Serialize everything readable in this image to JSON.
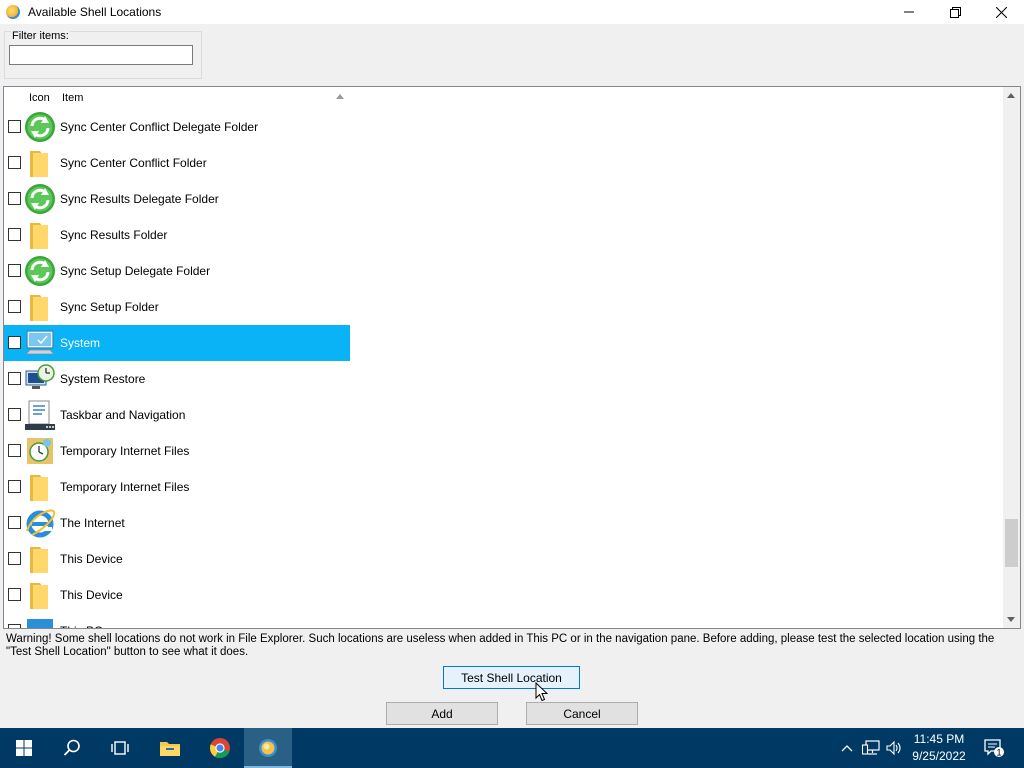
{
  "window": {
    "title": "Available Shell Locations"
  },
  "filter": {
    "label": "Filter items:",
    "value": "",
    "placeholder": ""
  },
  "list": {
    "columns": [
      "Icon",
      "Item"
    ],
    "items": [
      {
        "label": "Sync Center Conflict Delegate Folder",
        "icon": "sync-icon",
        "checked": false,
        "selected": false
      },
      {
        "label": "Sync Center Conflict Folder",
        "icon": "folder-icon",
        "checked": false,
        "selected": false
      },
      {
        "label": "Sync Results Delegate Folder",
        "icon": "sync-icon",
        "checked": false,
        "selected": false
      },
      {
        "label": "Sync Results Folder",
        "icon": "folder-icon",
        "checked": false,
        "selected": false
      },
      {
        "label": "Sync Setup Delegate Folder",
        "icon": "sync-icon",
        "checked": false,
        "selected": false
      },
      {
        "label": "Sync Setup Folder",
        "icon": "folder-icon",
        "checked": false,
        "selected": false
      },
      {
        "label": "System",
        "icon": "computer-icon",
        "checked": false,
        "selected": true
      },
      {
        "label": "System Restore",
        "icon": "system-restore-icon",
        "checked": false,
        "selected": false
      },
      {
        "label": "Taskbar and Navigation",
        "icon": "taskbar-settings-icon",
        "checked": false,
        "selected": false
      },
      {
        "label": "Temporary Internet Files",
        "icon": "temp-internet-files-icon",
        "checked": false,
        "selected": false
      },
      {
        "label": "Temporary Internet Files",
        "icon": "folder-icon",
        "checked": false,
        "selected": false
      },
      {
        "label": "The Internet",
        "icon": "internet-explorer-icon",
        "checked": false,
        "selected": false
      },
      {
        "label": "This Device",
        "icon": "folder-icon",
        "checked": false,
        "selected": false
      },
      {
        "label": "This Device",
        "icon": "folder-icon",
        "checked": false,
        "selected": false
      },
      {
        "label": "This PC",
        "icon": "this-pc-icon",
        "checked": false,
        "selected": false
      }
    ]
  },
  "warning": "Warning! Some shell locations do not work in File Explorer. Such locations are useless when added in This PC or in the navigation pane. Before adding, please test the selected location using the \"Test Shell Location\" button to see what it does.",
  "buttons": {
    "test": "Test Shell Location",
    "add": "Add",
    "cancel": "Cancel"
  },
  "taskbar": {
    "apps": [
      "start-icon",
      "search-icon",
      "task-view-icon",
      "file-explorer-icon",
      "chrome-icon",
      "winaero-tweaker-icon"
    ],
    "active_app": "winaero-tweaker-icon",
    "time": "11:45 PM",
    "date": "9/25/2022",
    "notifications": "1"
  },
  "colors": {
    "selection": "#0ab3f5",
    "taskbar": "#003a64",
    "focused_button_border": "#0078d7"
  }
}
